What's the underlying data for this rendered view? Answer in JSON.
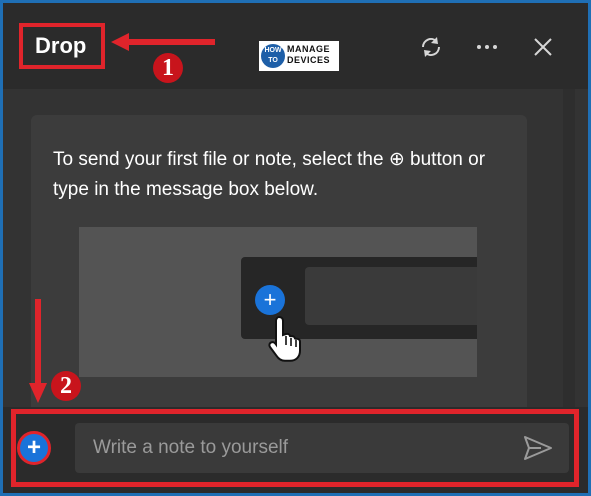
{
  "header": {
    "title": "Drop",
    "logo_how": "HOW TO",
    "logo_line1": "MANAGE",
    "logo_line2": "DEVICES",
    "callout_1": "1"
  },
  "content": {
    "instruction": "To send your first file or note, select the ⊕ button or type in the message box below."
  },
  "footer": {
    "placeholder": "Write a note to yourself",
    "callout_2": "2"
  },
  "colors": {
    "accent": "#1a73d9",
    "annotation": "#e0242b",
    "background": "#2b2b2b"
  },
  "icons": {
    "refresh": "refresh-icon",
    "more": "more-icon",
    "close": "close-icon",
    "add": "plus-icon",
    "send": "send-icon"
  }
}
